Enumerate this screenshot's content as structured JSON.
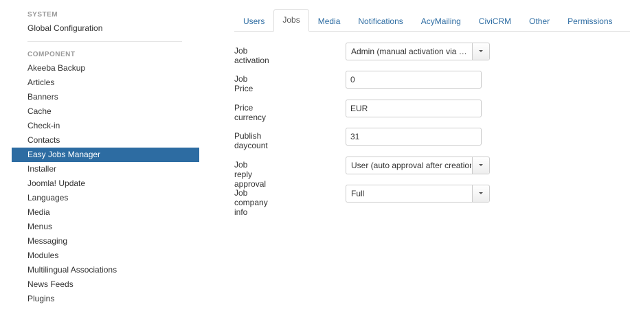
{
  "sidebar": {
    "system_header": "SYSTEM",
    "global_configuration": "Global Configuration",
    "component_header": "COMPONENT",
    "items": [
      {
        "label": "Akeeba Backup"
      },
      {
        "label": "Articles"
      },
      {
        "label": "Banners"
      },
      {
        "label": "Cache"
      },
      {
        "label": "Check-in"
      },
      {
        "label": "Contacts"
      },
      {
        "label": "Easy Jobs Manager"
      },
      {
        "label": "Installer"
      },
      {
        "label": "Joomla! Update"
      },
      {
        "label": "Languages"
      },
      {
        "label": "Media"
      },
      {
        "label": "Menus"
      },
      {
        "label": "Messaging"
      },
      {
        "label": "Modules"
      },
      {
        "label": "Multilingual Associations"
      },
      {
        "label": "News Feeds"
      },
      {
        "label": "Plugins"
      }
    ],
    "active_item": "Easy Jobs Manager"
  },
  "tabs": [
    {
      "label": "Users"
    },
    {
      "label": "Jobs"
    },
    {
      "label": "Media"
    },
    {
      "label": "Notifications"
    },
    {
      "label": "AcyMailing"
    },
    {
      "label": "CiviCRM"
    },
    {
      "label": "Other"
    },
    {
      "label": "Permissions"
    }
  ],
  "active_tab": "Jobs",
  "form": {
    "job_activation": {
      "label": "Job activation",
      "value": "Admin (manual activation via backend)"
    },
    "job_price": {
      "label": "Job Price",
      "value": "0"
    },
    "price_currency": {
      "label": "Price currency",
      "value": "EUR"
    },
    "publish_daycount": {
      "label": "Publish daycount",
      "value": "31"
    },
    "job_reply_approval": {
      "label": "Job reply approval",
      "value": "User (auto approval after creation)"
    },
    "job_company_info": {
      "label": "Job company info",
      "value": "Full"
    }
  },
  "colors": {
    "accent": "#2d6ca2",
    "header_text": "#999999"
  },
  "icons": {
    "dropdown": "caret-down-icon"
  }
}
